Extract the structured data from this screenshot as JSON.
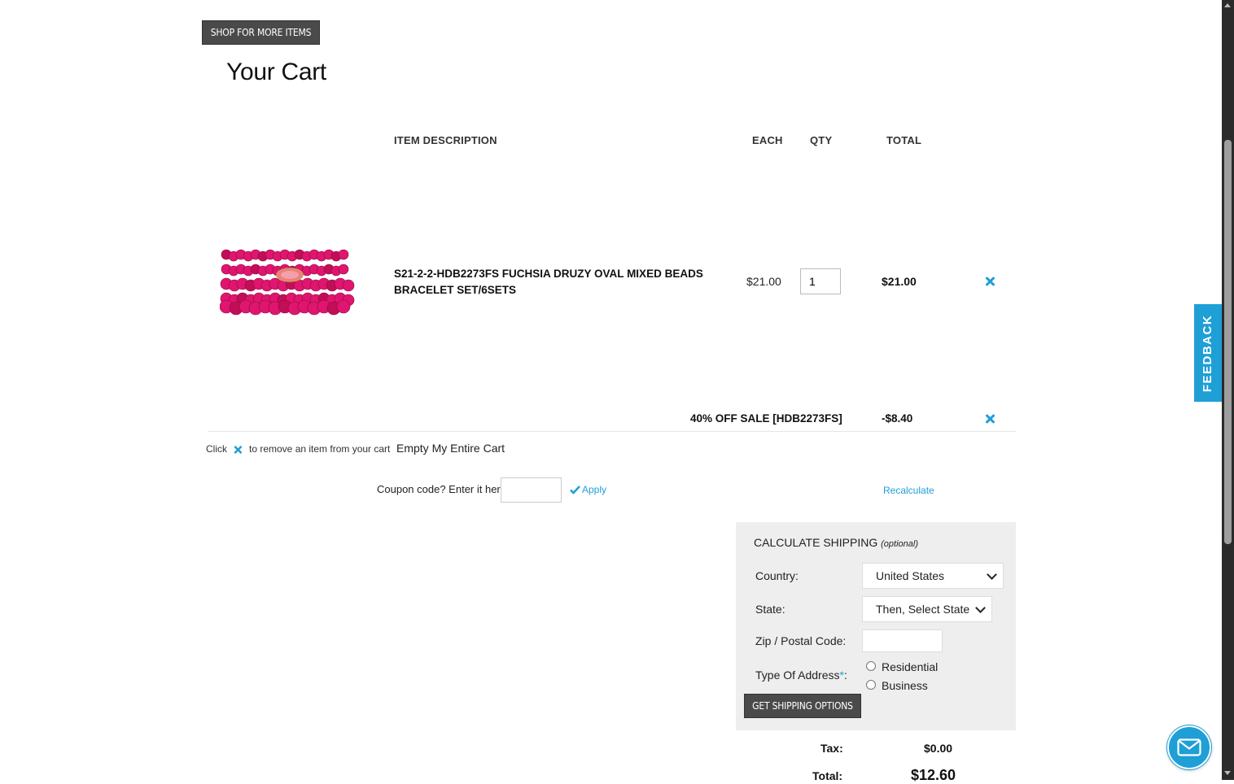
{
  "page": {
    "shop_button": "SHOP FOR MORE ITEMS",
    "title": "Your Cart"
  },
  "table_headers": {
    "item_description": "ITEM  DESCRIPTION",
    "each": "EACH",
    "qty": "QTY",
    "total": "TOTAL"
  },
  "cart_items": [
    {
      "name": "S21-2-2-HDB2273FS FUCHSIA DRUZY OVAL MIXED BEADS BRACELET SET/6SETS",
      "each": "$21.00",
      "qty": "1",
      "total": "$21.00",
      "image_icon": "beaded-bracelet-image"
    }
  ],
  "discount": {
    "label": "40% OFF SALE [HDB2273FS]",
    "amount": "-$8.40"
  },
  "remove_hint": {
    "prefix": "Click",
    "suffix": "to remove an item from your cart",
    "empty_cart": "Empty My Entire Cart"
  },
  "coupon": {
    "label": "Coupon code? Enter it here:",
    "value": "",
    "apply": "Apply",
    "recalculate": "Recalculate"
  },
  "shipping": {
    "title": "CALCULATE SHIPPING",
    "optional": "(optional)",
    "country_label": "Country:",
    "country_value": "United States",
    "state_label": "State:",
    "state_value": "Then, Select State",
    "zip_label": "Zip / Postal Code:",
    "zip_value": "",
    "address_type_label": "Type Of Address",
    "required_mark": "*",
    "address_type_colon": ":",
    "address_options": [
      "Residential",
      "Business"
    ],
    "button": "GET SHIPPING OPTIONS"
  },
  "summary": {
    "tax_label": "Tax:",
    "tax_value": "$0.00",
    "total_label": "Total:",
    "total_value": "$12.60"
  },
  "feedback_tab": "FEEDBACK",
  "colors": {
    "accent": "#1e9fd6",
    "dark_button": "#4a4a4a",
    "panel_bg": "#eeeeee",
    "bead_pink": "#e0156f"
  }
}
